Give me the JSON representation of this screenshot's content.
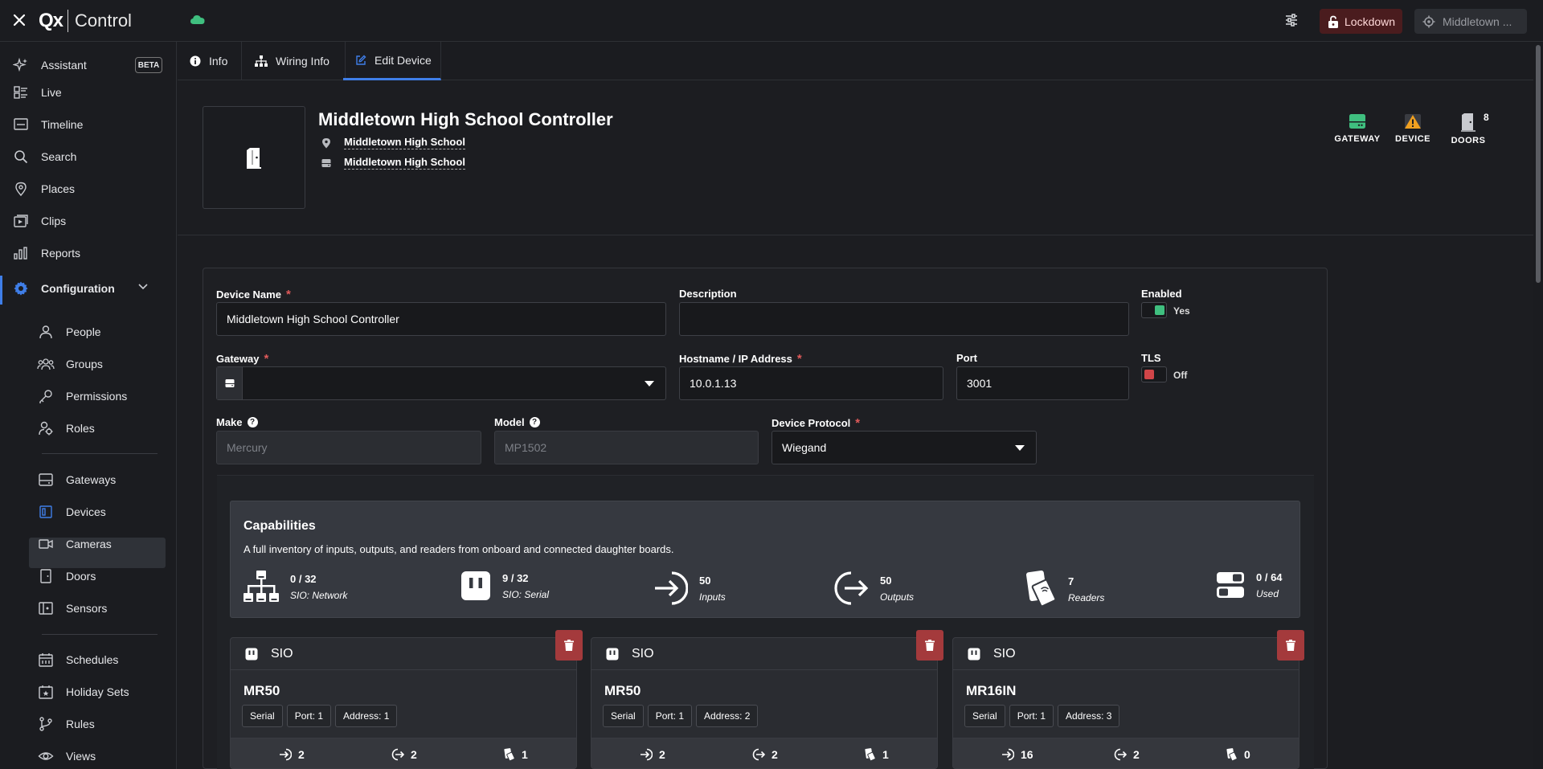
{
  "topbar": {
    "logo_mark": "Qx",
    "logo_text": "Control",
    "lockdown_label": "Lockdown",
    "site_label": "Middletown ..."
  },
  "sidebar": {
    "assistant": "Assistant",
    "beta": "BETA",
    "live": "Live",
    "timeline": "Timeline",
    "search": "Search",
    "places": "Places",
    "clips": "Clips",
    "reports": "Reports",
    "configuration": "Configuration",
    "people": "People",
    "groups": "Groups",
    "permissions": "Permissions",
    "roles": "Roles",
    "gateways": "Gateways",
    "devices": "Devices",
    "cameras": "Cameras",
    "doors": "Doors",
    "sensors": "Sensors",
    "schedules": "Schedules",
    "holiday_sets": "Holiday Sets",
    "rules": "Rules",
    "views": "Views"
  },
  "tabs": {
    "info": "Info",
    "wiring": "Wiring Info",
    "edit": "Edit Device"
  },
  "header": {
    "title": "Middletown High School Controller",
    "location": "Middletown High School",
    "site": "Middletown High School",
    "status_gateway": "GATEWAY",
    "status_device": "DEVICE",
    "status_doors": "DOORS",
    "doors_count": "8",
    "colors": {
      "gateway": "#3fbf7f",
      "device": "#f0a020"
    }
  },
  "form": {
    "device_name_label": "Device Name",
    "device_name_value": "Middletown High School Controller",
    "description_label": "Description",
    "description_value": "",
    "enabled_label": "Enabled",
    "enabled_value": "Yes",
    "gateway_label": "Gateway",
    "gateway_value": "",
    "hostname_label": "Hostname / IP Address",
    "hostname_value": "10.0.1.13",
    "port_label": "Port",
    "port_value": "3001",
    "tls_label": "TLS",
    "tls_value": "Off",
    "make_label": "Make",
    "make_value": "Mercury",
    "model_label": "Model",
    "model_value": "MP1502",
    "protocol_label": "Device Protocol",
    "protocol_value": "Wiegand",
    "required_mark": "*",
    "help_mark": "?"
  },
  "capabilities": {
    "title": "Capabilities",
    "description": "A full inventory of inputs, outputs, and readers from onboard and connected daughter boards.",
    "items": [
      {
        "value": "0 / 32",
        "label": "SIO: Network",
        "icon": "network-icon"
      },
      {
        "value": "9 / 32",
        "label": "SIO: Serial",
        "icon": "serial-icon"
      },
      {
        "value": "50",
        "label": "Inputs",
        "icon": "input-icon"
      },
      {
        "value": "50",
        "label": "Outputs",
        "icon": "output-icon"
      },
      {
        "value": "7",
        "label": "Readers",
        "icon": "reader-icon"
      },
      {
        "value": "0 / 64",
        "label": "Used",
        "icon": "toggles-icon"
      }
    ]
  },
  "sio_cards": [
    {
      "head": "SIO",
      "model": "MR50",
      "chips": [
        "Serial",
        "Port: 1",
        "Address: 1"
      ],
      "inputs": "2",
      "outputs": "2",
      "readers": "1"
    },
    {
      "head": "SIO",
      "model": "MR50",
      "chips": [
        "Serial",
        "Port: 1",
        "Address: 2"
      ],
      "inputs": "2",
      "outputs": "2",
      "readers": "1"
    },
    {
      "head": "SIO",
      "model": "MR16IN",
      "chips": [
        "Serial",
        "Port: 1",
        "Address: 3"
      ],
      "inputs": "16",
      "outputs": "2",
      "readers": "0"
    }
  ]
}
